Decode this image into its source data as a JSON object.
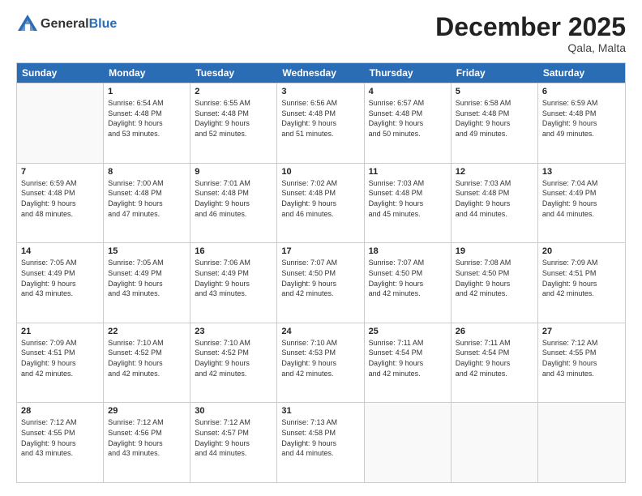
{
  "header": {
    "logo_general": "General",
    "logo_blue": "Blue",
    "month_title": "December 2025",
    "location": "Qala, Malta"
  },
  "weekdays": [
    "Sunday",
    "Monday",
    "Tuesday",
    "Wednesday",
    "Thursday",
    "Friday",
    "Saturday"
  ],
  "rows": [
    [
      {
        "day": "",
        "lines": [],
        "empty": true
      },
      {
        "day": "1",
        "lines": [
          "Sunrise: 6:54 AM",
          "Sunset: 4:48 PM",
          "Daylight: 9 hours",
          "and 53 minutes."
        ]
      },
      {
        "day": "2",
        "lines": [
          "Sunrise: 6:55 AM",
          "Sunset: 4:48 PM",
          "Daylight: 9 hours",
          "and 52 minutes."
        ]
      },
      {
        "day": "3",
        "lines": [
          "Sunrise: 6:56 AM",
          "Sunset: 4:48 PM",
          "Daylight: 9 hours",
          "and 51 minutes."
        ]
      },
      {
        "day": "4",
        "lines": [
          "Sunrise: 6:57 AM",
          "Sunset: 4:48 PM",
          "Daylight: 9 hours",
          "and 50 minutes."
        ]
      },
      {
        "day": "5",
        "lines": [
          "Sunrise: 6:58 AM",
          "Sunset: 4:48 PM",
          "Daylight: 9 hours",
          "and 49 minutes."
        ]
      },
      {
        "day": "6",
        "lines": [
          "Sunrise: 6:59 AM",
          "Sunset: 4:48 PM",
          "Daylight: 9 hours",
          "and 49 minutes."
        ]
      }
    ],
    [
      {
        "day": "7",
        "lines": [
          "Sunrise: 6:59 AM",
          "Sunset: 4:48 PM",
          "Daylight: 9 hours",
          "and 48 minutes."
        ]
      },
      {
        "day": "8",
        "lines": [
          "Sunrise: 7:00 AM",
          "Sunset: 4:48 PM",
          "Daylight: 9 hours",
          "and 47 minutes."
        ]
      },
      {
        "day": "9",
        "lines": [
          "Sunrise: 7:01 AM",
          "Sunset: 4:48 PM",
          "Daylight: 9 hours",
          "and 46 minutes."
        ]
      },
      {
        "day": "10",
        "lines": [
          "Sunrise: 7:02 AM",
          "Sunset: 4:48 PM",
          "Daylight: 9 hours",
          "and 46 minutes."
        ]
      },
      {
        "day": "11",
        "lines": [
          "Sunrise: 7:03 AM",
          "Sunset: 4:48 PM",
          "Daylight: 9 hours",
          "and 45 minutes."
        ]
      },
      {
        "day": "12",
        "lines": [
          "Sunrise: 7:03 AM",
          "Sunset: 4:48 PM",
          "Daylight: 9 hours",
          "and 44 minutes."
        ]
      },
      {
        "day": "13",
        "lines": [
          "Sunrise: 7:04 AM",
          "Sunset: 4:49 PM",
          "Daylight: 9 hours",
          "and 44 minutes."
        ]
      }
    ],
    [
      {
        "day": "14",
        "lines": [
          "Sunrise: 7:05 AM",
          "Sunset: 4:49 PM",
          "Daylight: 9 hours",
          "and 43 minutes."
        ]
      },
      {
        "day": "15",
        "lines": [
          "Sunrise: 7:05 AM",
          "Sunset: 4:49 PM",
          "Daylight: 9 hours",
          "and 43 minutes."
        ]
      },
      {
        "day": "16",
        "lines": [
          "Sunrise: 7:06 AM",
          "Sunset: 4:49 PM",
          "Daylight: 9 hours",
          "and 43 minutes."
        ]
      },
      {
        "day": "17",
        "lines": [
          "Sunrise: 7:07 AM",
          "Sunset: 4:50 PM",
          "Daylight: 9 hours",
          "and 42 minutes."
        ]
      },
      {
        "day": "18",
        "lines": [
          "Sunrise: 7:07 AM",
          "Sunset: 4:50 PM",
          "Daylight: 9 hours",
          "and 42 minutes."
        ]
      },
      {
        "day": "19",
        "lines": [
          "Sunrise: 7:08 AM",
          "Sunset: 4:50 PM",
          "Daylight: 9 hours",
          "and 42 minutes."
        ]
      },
      {
        "day": "20",
        "lines": [
          "Sunrise: 7:09 AM",
          "Sunset: 4:51 PM",
          "Daylight: 9 hours",
          "and 42 minutes."
        ]
      }
    ],
    [
      {
        "day": "21",
        "lines": [
          "Sunrise: 7:09 AM",
          "Sunset: 4:51 PM",
          "Daylight: 9 hours",
          "and 42 minutes."
        ]
      },
      {
        "day": "22",
        "lines": [
          "Sunrise: 7:10 AM",
          "Sunset: 4:52 PM",
          "Daylight: 9 hours",
          "and 42 minutes."
        ]
      },
      {
        "day": "23",
        "lines": [
          "Sunrise: 7:10 AM",
          "Sunset: 4:52 PM",
          "Daylight: 9 hours",
          "and 42 minutes."
        ]
      },
      {
        "day": "24",
        "lines": [
          "Sunrise: 7:10 AM",
          "Sunset: 4:53 PM",
          "Daylight: 9 hours",
          "and 42 minutes."
        ]
      },
      {
        "day": "25",
        "lines": [
          "Sunrise: 7:11 AM",
          "Sunset: 4:54 PM",
          "Daylight: 9 hours",
          "and 42 minutes."
        ]
      },
      {
        "day": "26",
        "lines": [
          "Sunrise: 7:11 AM",
          "Sunset: 4:54 PM",
          "Daylight: 9 hours",
          "and 42 minutes."
        ]
      },
      {
        "day": "27",
        "lines": [
          "Sunrise: 7:12 AM",
          "Sunset: 4:55 PM",
          "Daylight: 9 hours",
          "and 43 minutes."
        ]
      }
    ],
    [
      {
        "day": "28",
        "lines": [
          "Sunrise: 7:12 AM",
          "Sunset: 4:55 PM",
          "Daylight: 9 hours",
          "and 43 minutes."
        ]
      },
      {
        "day": "29",
        "lines": [
          "Sunrise: 7:12 AM",
          "Sunset: 4:56 PM",
          "Daylight: 9 hours",
          "and 43 minutes."
        ]
      },
      {
        "day": "30",
        "lines": [
          "Sunrise: 7:12 AM",
          "Sunset: 4:57 PM",
          "Daylight: 9 hours",
          "and 44 minutes."
        ]
      },
      {
        "day": "31",
        "lines": [
          "Sunrise: 7:13 AM",
          "Sunset: 4:58 PM",
          "Daylight: 9 hours",
          "and 44 minutes."
        ]
      },
      {
        "day": "",
        "lines": [],
        "empty": true
      },
      {
        "day": "",
        "lines": [],
        "empty": true
      },
      {
        "day": "",
        "lines": [],
        "empty": true
      }
    ]
  ]
}
